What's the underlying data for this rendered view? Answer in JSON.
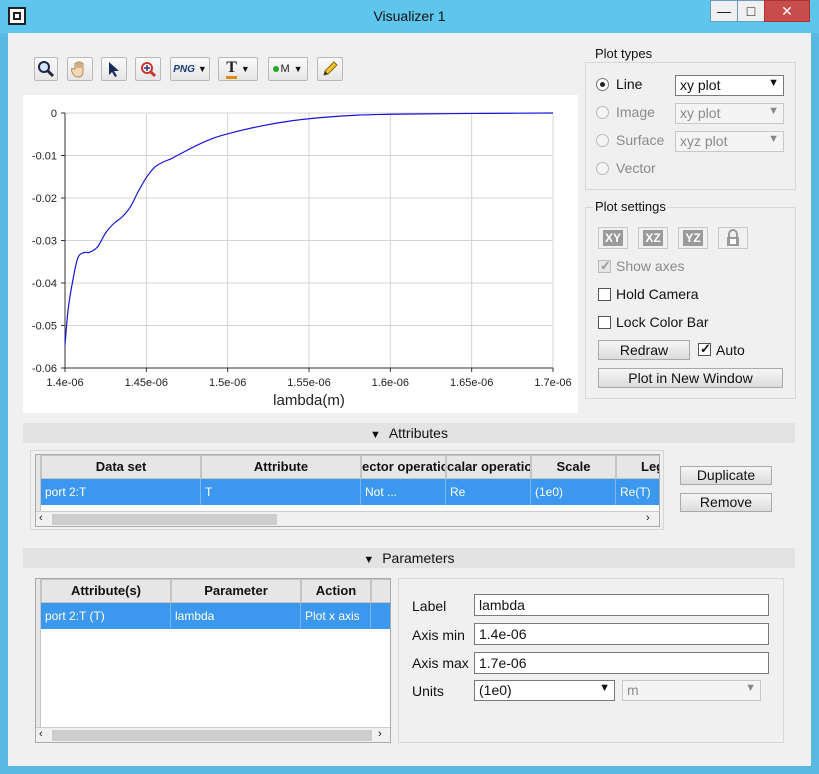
{
  "window": {
    "title": "Visualizer 1",
    "minimize_label": "—",
    "maximize_label": "□",
    "close_label": "✕"
  },
  "toolbar": {
    "tools": [
      "zoom-icon",
      "pan-hand-icon",
      "select-arrow-icon",
      "zoom-region-icon",
      "export-png-icon",
      "text-format-icon",
      "marker-icon",
      "pencil-icon"
    ],
    "png_label": "PNG",
    "text_label": "T",
    "marker_label": "M"
  },
  "chart_data": {
    "type": "line",
    "xlabel": "lambda(m)",
    "ylabel": "",
    "xlim": [
      1.4e-06,
      1.7e-06
    ],
    "ylim": [
      -0.06,
      0
    ],
    "x_ticks": [
      "1.4e-06",
      "1.45e-06",
      "1.5e-06",
      "1.55e-06",
      "1.6e-06",
      "1.65e-06",
      "1.7e-06"
    ],
    "y_ticks": [
      "0",
      "-0.01",
      "-0.02",
      "-0.03",
      "-0.04",
      "-0.05",
      "-0.06"
    ],
    "grid": true,
    "line_color": "#1515d8",
    "series": [
      {
        "x": [
          1.4e-06,
          1.402e-06,
          1.405e-06,
          1.408e-06,
          1.412e-06,
          1.415e-06,
          1.42e-06,
          1.425e-06,
          1.43e-06,
          1.435e-06,
          1.44e-06,
          1.445e-06,
          1.45e-06,
          1.455e-06,
          1.46e-06,
          1.465e-06,
          1.47e-06,
          1.48e-06,
          1.49e-06,
          1.5e-06,
          1.52e-06,
          1.54e-06,
          1.56e-06,
          1.58e-06,
          1.6e-06,
          1.62e-06,
          1.65e-06,
          1.68e-06,
          1.7e-06
        ],
        "y": [
          -0.0545,
          -0.046,
          -0.039,
          -0.034,
          -0.0328,
          -0.0328,
          -0.0315,
          -0.0282,
          -0.026,
          -0.0245,
          -0.0222,
          -0.0185,
          -0.0152,
          -0.0128,
          -0.0116,
          -0.0108,
          -0.0098,
          -0.0078,
          -0.0061,
          -0.0049,
          -0.0031,
          -0.0018,
          -0.001,
          -0.0005,
          -0.0003,
          -0.0002,
          -0.0001,
          -5e-05,
          0
        ]
      }
    ]
  },
  "plot_types": {
    "title": "Plot types",
    "rows": [
      {
        "label": "Line",
        "value": "xy plot",
        "selected": true,
        "enabled": true
      },
      {
        "label": "Image",
        "value": "xy plot",
        "selected": false,
        "enabled": false
      },
      {
        "label": "Surface",
        "value": "xyz plot",
        "selected": false,
        "enabled": false
      },
      {
        "label": "Vector",
        "selected": false,
        "enabled": false
      }
    ]
  },
  "plot_settings": {
    "title": "Plot settings",
    "view_buttons": [
      "XY",
      "XZ",
      "YZ"
    ],
    "show_axes_label": "Show axes",
    "hold_camera_label": "Hold Camera",
    "lock_color_bar_label": "Lock Color Bar",
    "redraw_label": "Redraw",
    "auto_label": "Auto",
    "plot_new_window_label": "Plot in New Window"
  },
  "attributes": {
    "header": "Attributes",
    "columns": [
      "Data set",
      "Attribute",
      "ector operatic",
      "calar operatio",
      "Scale",
      "Lege"
    ],
    "rows": [
      [
        "port 2:T",
        "T",
        "Not ...",
        "Re",
        "(1e0)",
        "Re(T)"
      ]
    ],
    "duplicate_label": "Duplicate",
    "remove_label": "Remove"
  },
  "parameters": {
    "header": "Parameters",
    "columns": [
      "Attribute(s)",
      "Parameter",
      "Action"
    ],
    "rows": [
      [
        "port 2:T (T)",
        "lambda",
        "Plot x axis"
      ]
    ],
    "label_label": "Label",
    "label_value": "lambda",
    "axis_min_label": "Axis min",
    "axis_min_value": "1.4e-06",
    "axis_max_label": "Axis max",
    "axis_max_value": "1.7e-06",
    "units_label": "Units",
    "units_value": "(1e0)",
    "units_unit": "m"
  }
}
